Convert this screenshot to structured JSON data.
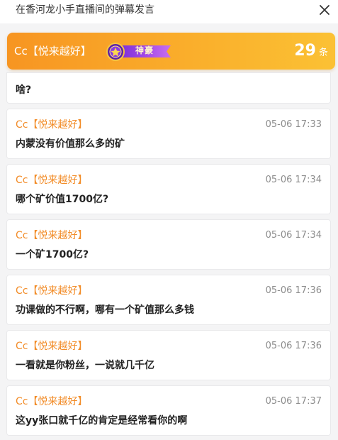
{
  "window": {
    "title": "在香河龙小手直播间的弹幕发言"
  },
  "header": {
    "username": "Cc【悦来越好】",
    "badge_label": "神豪",
    "count": "29",
    "count_unit": "条"
  },
  "first_message": {
    "text": "啥?"
  },
  "messages": [
    {
      "user": "Cc【悦来越好】",
      "time": "05-06 17:33",
      "text": "内蒙没有价值那么多的矿"
    },
    {
      "user": "Cc【悦来越好】",
      "time": "05-06 17:34",
      "text": "哪个矿价值1700亿?"
    },
    {
      "user": "Cc【悦来越好】",
      "time": "05-06 17:34",
      "text": "一个矿1700亿?"
    },
    {
      "user": "Cc【悦来越好】",
      "time": "05-06 17:36",
      "text": "功课做的不行啊，哪有一个矿值那么多钱"
    },
    {
      "user": "Cc【悦来越好】",
      "time": "05-06 17:36",
      "text": "一看就是你粉丝，一说就几千亿"
    },
    {
      "user": "Cc【悦来越好】",
      "time": "05-06 17:37",
      "text": "这yy张口就千亿的肯定是经常看你的啊"
    }
  ],
  "colors": {
    "header_gradient_start": "#f79522",
    "header_gradient_end": "#fbc134",
    "username": "#f28c28",
    "badge_ribbon": "#a64be8"
  },
  "icons": {
    "close": "close-icon",
    "badge_emblem": "shenhao-badge-icon"
  }
}
